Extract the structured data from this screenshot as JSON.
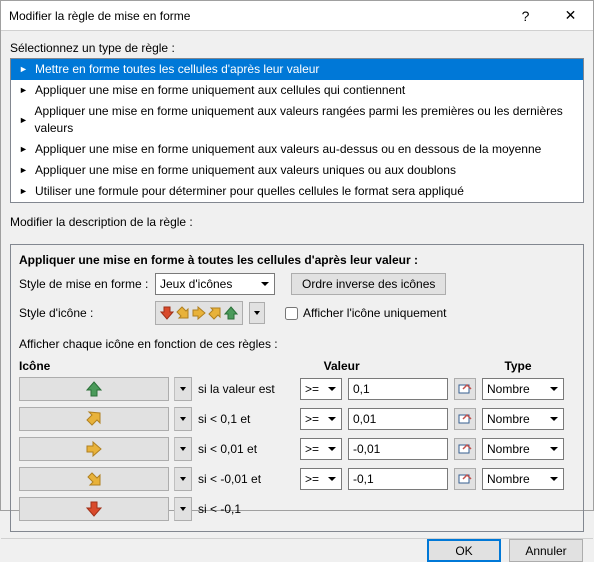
{
  "title": "Modifier la règle de mise en forme",
  "section1": "Sélectionnez un type de règle :",
  "rules": [
    "Mettre en forme toutes les cellules d'après leur valeur",
    "Appliquer une mise en forme uniquement aux cellules qui contiennent",
    "Appliquer une mise en forme uniquement aux valeurs rangées parmi les premières ou les dernières valeurs",
    "Appliquer une mise en forme uniquement aux valeurs au-dessus ou en dessous de la moyenne",
    "Appliquer une mise en forme uniquement aux valeurs uniques ou aux doublons",
    "Utiliser une formule pour déterminer pour quelles cellules le format sera appliqué"
  ],
  "section2": "Modifier la description de la règle :",
  "desc_title": "Appliquer une mise en forme à toutes les cellules d'après leur valeur :",
  "style_label": "Style de mise en forme :",
  "style_value": "Jeux d'icônes",
  "reverse_btn": "Ordre inverse des icônes",
  "icon_style_label": "Style d'icône :",
  "icon_only": "Afficher l'icône uniquement",
  "rules_label": "Afficher chaque icône en fonction de ces règles :",
  "hdr_icon": "Icône",
  "hdr_val": "Valeur",
  "hdr_type": "Type",
  "rows": [
    {
      "icon": "green-up",
      "cond": "si la valeur est",
      "op": ">=",
      "val": "0,1",
      "type": "Nombre"
    },
    {
      "icon": "yellow-upright",
      "cond": "si < 0,1 et",
      "op": ">=",
      "val": "0,01",
      "type": "Nombre"
    },
    {
      "icon": "yellow-right",
      "cond": "si < 0,01 et",
      "op": ">=",
      "val": "-0,01",
      "type": "Nombre"
    },
    {
      "icon": "yellow-downright",
      "cond": "si < -0,01 et",
      "op": ">=",
      "val": "-0,1",
      "type": "Nombre"
    },
    {
      "icon": "red-down",
      "cond": "si < -0,1",
      "op": "",
      "val": "",
      "type": ""
    }
  ],
  "ok": "OK",
  "cancel": "Annuler"
}
